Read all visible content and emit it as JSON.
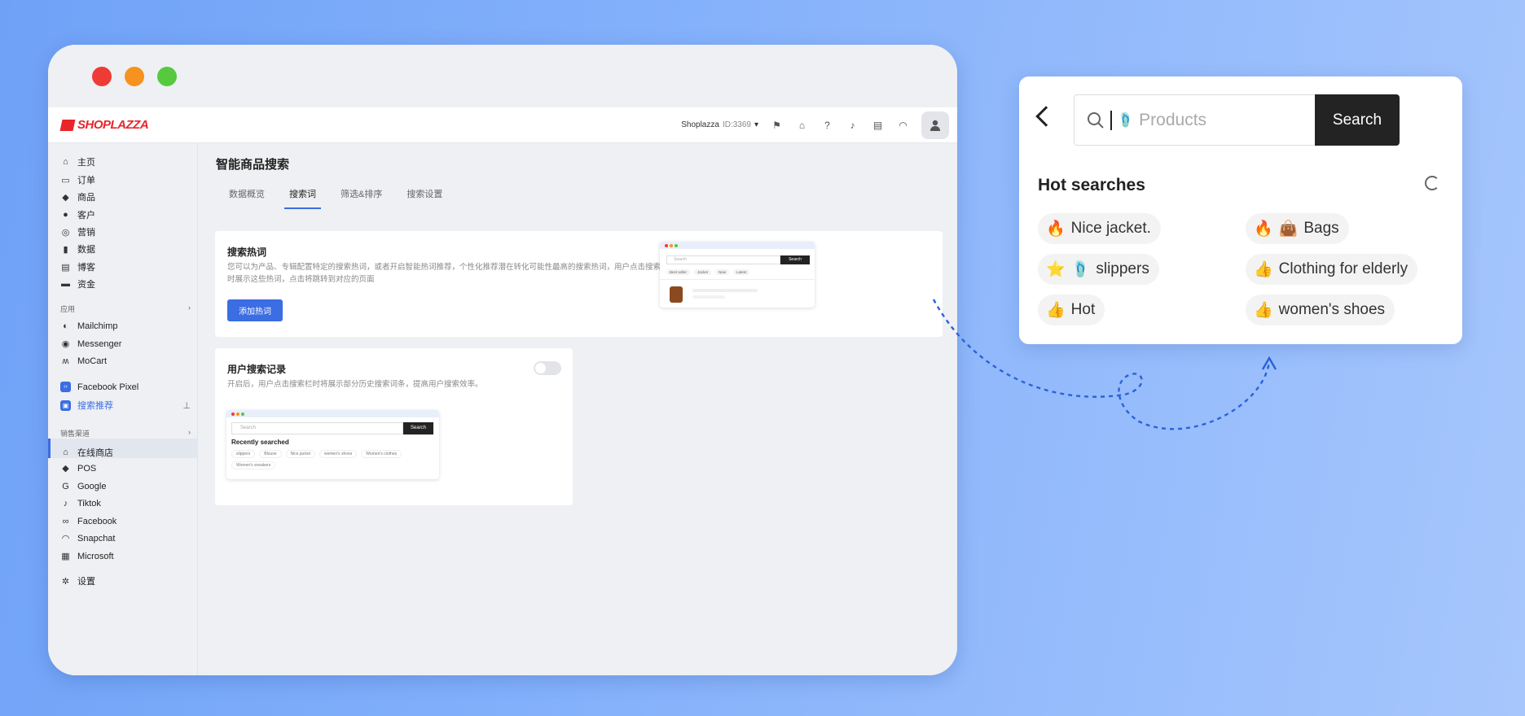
{
  "window": {
    "dots": [
      "#ee3b35",
      "#f6921e",
      "#57c93e"
    ]
  },
  "topbar": {
    "logo": "SHOPLAZZA",
    "store_name": "Shoplazza",
    "store_id": "ID:3369"
  },
  "sidebar": {
    "items": [
      {
        "label": "主页",
        "icon": "home-icon",
        "glyph": "⌂"
      },
      {
        "label": "订单",
        "icon": "inbox-icon",
        "glyph": "▭"
      },
      {
        "label": "商品",
        "icon": "tag-icon",
        "glyph": "◆"
      },
      {
        "label": "客户",
        "icon": "person-icon",
        "glyph": "●"
      },
      {
        "label": "营销",
        "icon": "target-icon",
        "glyph": "◎"
      },
      {
        "label": "数据",
        "icon": "chart-icon",
        "glyph": "▮"
      },
      {
        "label": "博客",
        "icon": "blog-icon",
        "glyph": "▤"
      },
      {
        "label": "资金",
        "icon": "wallet-icon",
        "glyph": "▬"
      }
    ],
    "apps_header": "应用",
    "apps": [
      {
        "label": "Mailchimp",
        "icon": "mailchimp-icon",
        "glyph": "◐"
      },
      {
        "label": "Messenger",
        "icon": "messenger-icon",
        "glyph": "◉"
      },
      {
        "label": "MoCart",
        "icon": "mocart-icon",
        "glyph": "ʍ"
      }
    ],
    "extra": [
      {
        "label": "Facebook Pixel",
        "icon": "code-icon",
        "glyph": "‹›"
      },
      {
        "label": "搜索推荐",
        "icon": "search-app-icon",
        "glyph": "▣"
      }
    ],
    "channels_header": "销售渠道",
    "channels": [
      {
        "label": "在线商店",
        "icon": "store-icon",
        "glyph": "⌂"
      },
      {
        "label": "POS",
        "icon": "pos-icon",
        "glyph": "◆"
      },
      {
        "label": "Google",
        "icon": "google-icon",
        "glyph": "G"
      },
      {
        "label": "Tiktok",
        "icon": "tiktok-icon",
        "glyph": "♪"
      },
      {
        "label": "Facebook",
        "icon": "meta-icon",
        "glyph": "∞"
      },
      {
        "label": "Snapchat",
        "icon": "snapchat-icon",
        "glyph": "◠"
      },
      {
        "label": "Microsoft",
        "icon": "microsoft-icon",
        "glyph": "▦"
      }
    ],
    "settings": {
      "label": "设置",
      "icon": "gear-icon",
      "glyph": "✲"
    }
  },
  "main": {
    "title": "智能商品搜索",
    "tabs": [
      "数据概览",
      "搜索词",
      "筛选&排序",
      "搜索设置"
    ],
    "card1": {
      "title": "搜索热词",
      "desc_line1": "您可以为产品、专辑配置特定的搜索热词，或者开启智能热词推荐，个性化推荐潜在转化可能性最高的搜索热词，用户点击搜索栏",
      "desc_line2": "时展示这些热词，点击将跳转到对应的页面",
      "button": "添加热词",
      "preview": {
        "placeholder": "Search",
        "button": "Search",
        "chips": [
          "Best seller",
          "Jacket",
          "New",
          "Latest"
        ]
      }
    },
    "card2": {
      "title": "用户搜索记录",
      "desc": "开启后，用户点击搜索栏时将展示部分历史搜索词条，提高用户搜索效率。",
      "preview": {
        "placeholder": "Search",
        "button": "Search",
        "heading": "Recently searched",
        "chips": [
          "slippers",
          "Blouse",
          "Nice jacket",
          "women's shoes",
          "Women's clothes",
          "Women's sneakers"
        ]
      }
    }
  },
  "panel": {
    "placeholder": "Products",
    "search_button": "Search",
    "heading": "Hot searches",
    "chips": [
      {
        "emoji": "🔥",
        "emoji2": "",
        "label": "Nice jacket."
      },
      {
        "emoji": "🔥",
        "emoji2": "👜",
        "label": "Bags"
      },
      {
        "emoji": "⭐",
        "emoji2": "🩴",
        "label": "slippers"
      },
      {
        "emoji": "👍",
        "emoji2": "",
        "label": "Clothing for elderly"
      },
      {
        "emoji": "👍",
        "emoji2": "",
        "label": "Hot"
      },
      {
        "emoji": "👍",
        "emoji2": "",
        "label": "women's shoes"
      }
    ]
  },
  "colors": {
    "accent": "#3b6de3",
    "brand": "#e8262a",
    "dark_button": "#232323"
  }
}
